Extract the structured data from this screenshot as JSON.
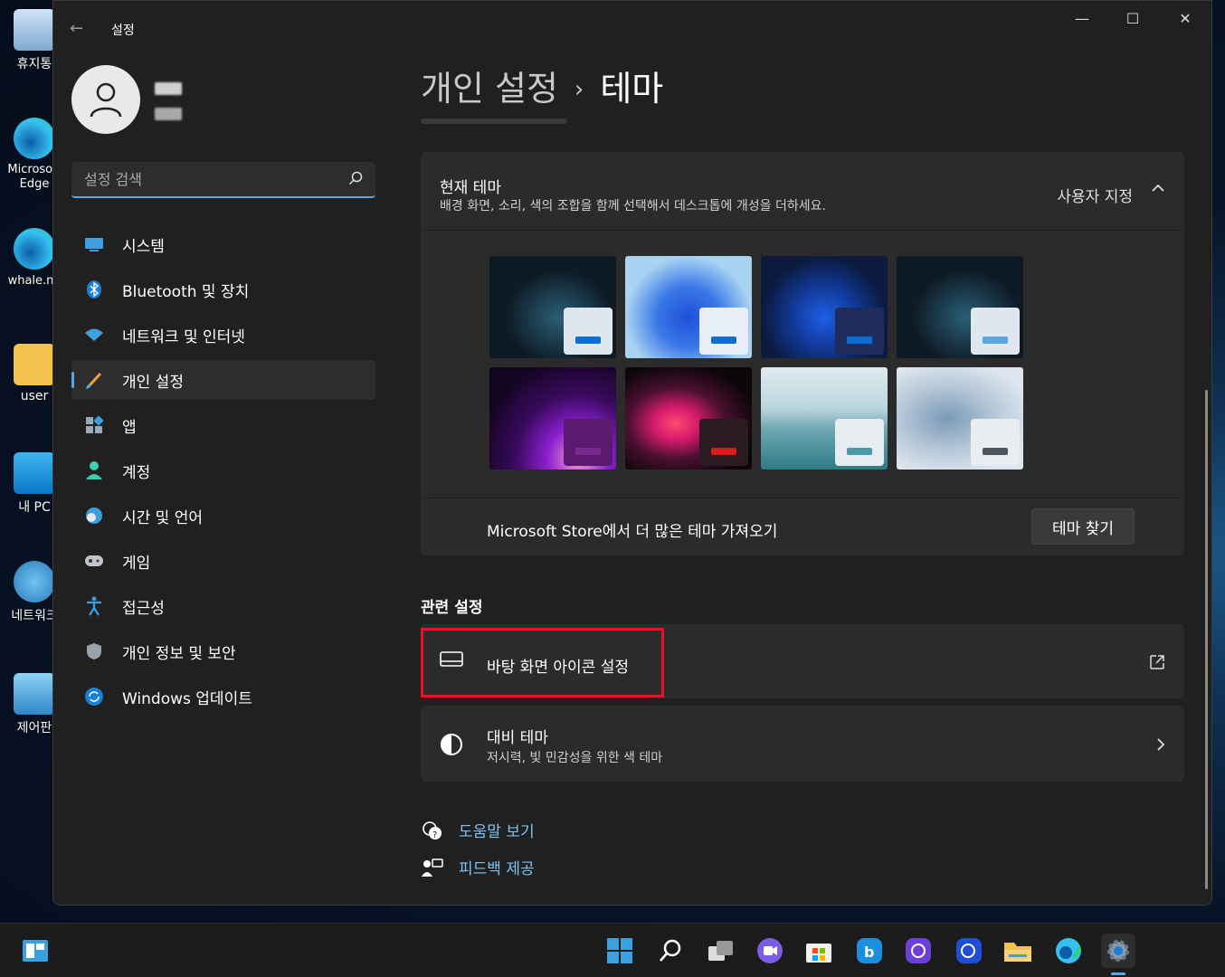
{
  "desktop": {
    "icons": [
      {
        "label": "휴지통",
        "name": "recycle-bin"
      },
      {
        "label": "Microsoft Edge",
        "name": "edge"
      },
      {
        "label": "whale.na",
        "name": "whale"
      },
      {
        "label": "user",
        "name": "user-folder"
      },
      {
        "label": "내 PC",
        "name": "my-pc"
      },
      {
        "label": "네트워크",
        "name": "network"
      },
      {
        "label": "제어판",
        "name": "control-panel"
      }
    ]
  },
  "window": {
    "title": "설정",
    "back_glyph": "←",
    "minimize_glyph": "—",
    "maximize_glyph": "☐",
    "close_glyph": "✕"
  },
  "sidebar": {
    "search_placeholder": "설정 검색",
    "items": [
      {
        "label": "시스템",
        "icon": "system-icon"
      },
      {
        "label": "Bluetooth 및 장치",
        "icon": "bluetooth-icon"
      },
      {
        "label": "네트워크 및 인터넷",
        "icon": "wifi-icon"
      },
      {
        "label": "개인 설정",
        "icon": "brush-icon",
        "active": true
      },
      {
        "label": "앱",
        "icon": "apps-icon"
      },
      {
        "label": "계정",
        "icon": "account-icon"
      },
      {
        "label": "시간 및 언어",
        "icon": "time-language-icon"
      },
      {
        "label": "게임",
        "icon": "gaming-icon"
      },
      {
        "label": "접근성",
        "icon": "accessibility-icon"
      },
      {
        "label": "개인 정보 및 보안",
        "icon": "shield-icon"
      },
      {
        "label": "Windows 업데이트",
        "icon": "update-icon"
      }
    ]
  },
  "main": {
    "breadcrumb": {
      "parent": "개인 설정",
      "separator": "›",
      "current": "테마"
    },
    "theme_card": {
      "title": "현재 테마",
      "description": "배경 화면, 소리, 색의 조합을 함께 선택해서 데스크톱에 개성을 더하세요.",
      "value": "사용자 지정",
      "themes": [
        {
          "name": "theme-dark-custom",
          "bg": "#0e1a24",
          "mini": "#dfe6ee",
          "bar": "#0a6fd0"
        },
        {
          "name": "theme-windows-light",
          "bg": "#8ec3ea",
          "mini": "#e8eef5",
          "bar": "#0a6fd0"
        },
        {
          "name": "theme-windows-dark",
          "bg": "#0b1a3d",
          "mini": "#1f2d5c",
          "bar": "#0a6fd0"
        },
        {
          "name": "theme-dark-custom-2",
          "bg": "#0e1a24",
          "mini": "#dfe6ee",
          "bar": "#5aa7e6"
        },
        {
          "name": "theme-glow",
          "bg": "#2a0a3d",
          "mini": "#5c1a6e",
          "bar": "#7a2a8e"
        },
        {
          "name": "theme-captured-motion",
          "bg": "#1a0d14",
          "mini": "#2a1a22",
          "bar": "#d81b1b"
        },
        {
          "name": "theme-sunrise",
          "bg": "#7fb5c2",
          "mini": "#e6ecef",
          "bar": "#4a9aa8"
        },
        {
          "name": "theme-flow",
          "bg": "#b7c8d8",
          "mini": "#e8edf2",
          "bar": "#4a5560"
        }
      ],
      "store_text": "Microsoft Store에서 더 많은 테마 가져오기",
      "store_button": "테마 찾기"
    },
    "related_title": "관련 설정",
    "desktop_icons_setting": "바탕 화면 아이콘 설정",
    "contrast": {
      "title": "대비 테마",
      "subtitle": "저시력, 빛 민감성을 위한 색 테마"
    },
    "help_links": [
      {
        "label": "도움말 보기",
        "icon": "help-icon"
      },
      {
        "label": "피드백 제공",
        "icon": "feedback-icon"
      }
    ]
  },
  "colors": {
    "accent": "#5aa7e6",
    "highlight": "#e81224",
    "link": "#7cc3f5"
  },
  "taskbar": {
    "items": [
      "widgets-icon",
      "start-icon",
      "search-icon",
      "task-view-icon",
      "chat-icon",
      "store-icon",
      "bing-icon",
      "app-icon-purple",
      "app-icon-blue",
      "file-explorer-icon",
      "edge-icon",
      "settings-icon"
    ]
  }
}
